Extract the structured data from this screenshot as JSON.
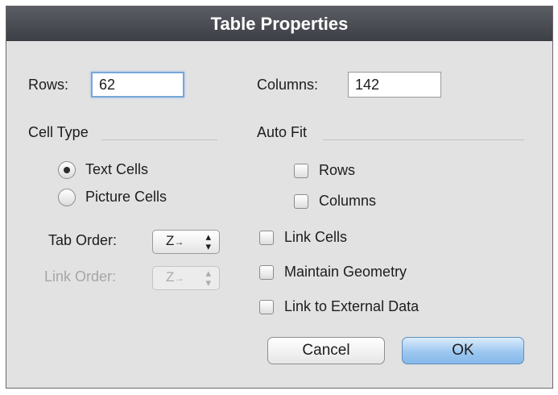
{
  "dialog": {
    "title": "Table Properties"
  },
  "rows": {
    "label": "Rows:",
    "value": "62"
  },
  "columns": {
    "label": "Columns:",
    "value": "142"
  },
  "cell_type": {
    "heading": "Cell Type",
    "options": [
      {
        "label": "Text Cells",
        "selected": true
      },
      {
        "label": "Picture Cells",
        "selected": false
      }
    ]
  },
  "auto_fit": {
    "heading": "Auto Fit",
    "rows_label": "Rows",
    "columns_label": "Columns"
  },
  "tab_order": {
    "label": "Tab Order:",
    "value_icon": "z-order-icon",
    "enabled": true
  },
  "link_order": {
    "label": "Link Order:",
    "value_icon": "z-order-icon",
    "enabled": false
  },
  "options": {
    "link_cells": "Link Cells",
    "maintain_geometry": "Maintain Geometry",
    "link_external_data": "Link to External Data"
  },
  "buttons": {
    "cancel": "Cancel",
    "ok": "OK"
  },
  "colors": {
    "title_bar": "#44474d",
    "dialog_bg": "#e2e2e2",
    "focus_ring": "#78a6d8",
    "default_button": "#9cc7f0"
  }
}
